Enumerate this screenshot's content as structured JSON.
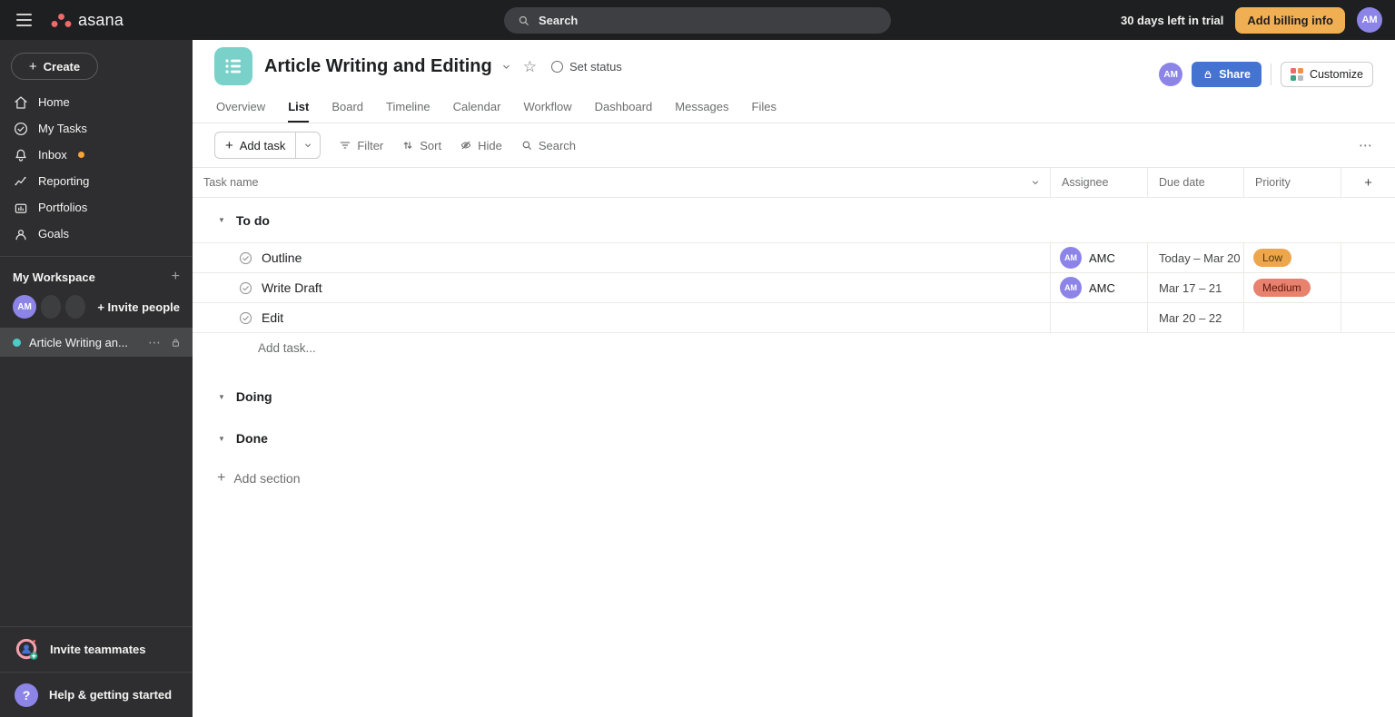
{
  "icons": {
    "plus": "+",
    "ellipsis": "⋯",
    "star": "☆",
    "section_triangle": "▼",
    "question_mark": "?"
  },
  "topbar": {
    "logo_text": "asana",
    "search_label": "Search",
    "trial_text": "30 days left in trial",
    "billing_button": "Add billing info",
    "avatar_initials": "AM"
  },
  "sidebar": {
    "create_button": "Create",
    "nav": [
      {
        "label": "Home"
      },
      {
        "label": "My Tasks"
      },
      {
        "label": "Inbox"
      },
      {
        "label": "Reporting"
      },
      {
        "label": "Portfolios"
      },
      {
        "label": "Goals"
      }
    ],
    "workspace": {
      "title": "My Workspace",
      "avatar_initials": "AM",
      "invite_label": "+ Invite people",
      "project_label": "Article Writing an..."
    },
    "footer": {
      "invite_label": "Invite teammates",
      "help_label": "Help & getting started"
    }
  },
  "header": {
    "title": "Article Writing and Editing",
    "set_status_label": "Set status",
    "avatar_initials": "AM",
    "share_button": "Share",
    "customize_button": "Customize",
    "tabs": [
      {
        "label": "Overview"
      },
      {
        "label": "List",
        "active": true
      },
      {
        "label": "Board"
      },
      {
        "label": "Timeline"
      },
      {
        "label": "Calendar"
      },
      {
        "label": "Workflow"
      },
      {
        "label": "Dashboard"
      },
      {
        "label": "Messages"
      },
      {
        "label": "Files"
      }
    ]
  },
  "toolbar": {
    "add_task_label": "Add task",
    "filter_label": "Filter",
    "sort_label": "Sort",
    "hide_label": "Hide",
    "search_label": "Search"
  },
  "table": {
    "columns": [
      {
        "label": "Task name"
      },
      {
        "label": "Assignee"
      },
      {
        "label": "Due date"
      },
      {
        "label": "Priority"
      }
    ],
    "sections": [
      {
        "name": "To do",
        "tasks": [
          {
            "name": "Outline",
            "assignee_initials": "AM",
            "assignee": "AMC",
            "due": "Today – Mar 20",
            "priority": "Low"
          },
          {
            "name": "Write Draft",
            "assignee_initials": "AM",
            "assignee": "AMC",
            "due": "Mar 17 – 21",
            "priority": "Medium"
          },
          {
            "name": "Edit",
            "assignee_initials": "",
            "assignee": "",
            "due": "Mar 20 – 22",
            "priority": ""
          }
        ],
        "add_task_label": "Add task..."
      },
      {
        "name": "Doing",
        "tasks": []
      },
      {
        "name": "Done",
        "tasks": []
      }
    ],
    "add_section_label": "Add section"
  },
  "colors": {
    "topbar_bg": "#1e1f21",
    "sidebar_bg": "#2e2e30",
    "accent_teal": "#4ecbc4",
    "share_blue": "#4573d2",
    "billing_amber": "#f1af54",
    "avatar_purple": "#8d84e8",
    "priority_low_bg": "#eea64c",
    "priority_medium_bg": "#e8816e",
    "inbox_dot": "#f8a437",
    "logo_coral": "#f06a6a"
  }
}
